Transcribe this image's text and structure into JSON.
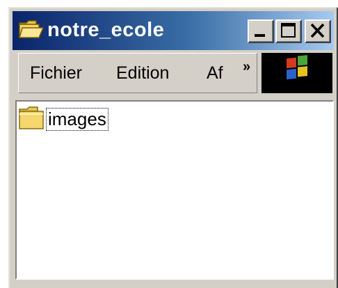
{
  "window": {
    "title": "notre_ecole"
  },
  "title_buttons": {
    "minimize": "minimize-icon",
    "maximize": "maximize-icon",
    "close": "close-icon"
  },
  "menu": {
    "items": [
      "Fichier",
      "Edition",
      "Af"
    ],
    "overflow": "»"
  },
  "content": {
    "items": [
      {
        "label": "images",
        "icon": "folder-icon"
      }
    ]
  },
  "colors": {
    "titlebar_start": "#0a246a",
    "titlebar_end": "#a6caf0",
    "chrome": "#d4d0c8",
    "folder": "#f5d76e"
  }
}
